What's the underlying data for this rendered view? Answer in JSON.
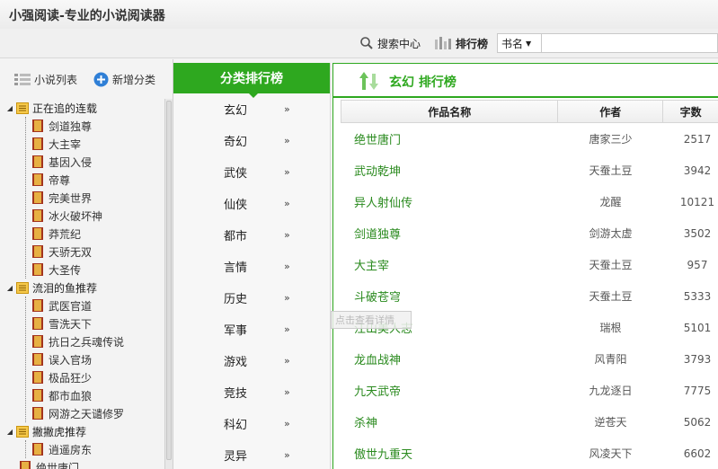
{
  "window": {
    "title": "小强阅读-专业的小说阅读器"
  },
  "toolbar": {
    "search_label": "搜索中心",
    "rank_label": "排行榜",
    "select_value": "书名"
  },
  "sidebar": {
    "novel_list_label": "小说列表",
    "add_category_label": "新增分类",
    "groups": [
      {
        "label": "正在追的连载",
        "items": [
          "剑道独尊",
          "大主宰",
          "基因入侵",
          "帝尊",
          "完美世界",
          "冰火破坏神",
          "莽荒纪",
          "天骄无双",
          "大圣传"
        ]
      },
      {
        "label": "流泪的鱼推荐",
        "items": [
          "武医官道",
          "雪洗天下",
          "抗日之兵魂传说",
          "误入官场",
          "极品狂少",
          "都市血狼",
          "网游之天谴修罗"
        ]
      },
      {
        "label": "撇撇虎推荐",
        "items": [
          "逍遥房东"
        ]
      }
    ],
    "trailing_item": "绝世唐门"
  },
  "categories": {
    "header": "分类排行榜",
    "chevron": "»",
    "items": [
      "玄幻",
      "奇幻",
      "武侠",
      "仙侠",
      "都市",
      "言情",
      "历史",
      "军事",
      "游戏",
      "竞技",
      "科幻",
      "灵异"
    ]
  },
  "ranking": {
    "title": "玄幻 排行榜",
    "columns": [
      "作品名称",
      "作者",
      "字数"
    ],
    "rows": [
      {
        "name": "绝世唐门",
        "author": "唐家三少",
        "words": "2517"
      },
      {
        "name": "武动乾坤",
        "author": "天蚕土豆",
        "words": "3942"
      },
      {
        "name": "异人射仙传",
        "author": "龙醒",
        "words": "10121"
      },
      {
        "name": "剑道独尊",
        "author": "剑游太虚",
        "words": "3502"
      },
      {
        "name": "大主宰",
        "author": "天蚕土豆",
        "words": "957"
      },
      {
        "name": "斗破苍穹",
        "author": "天蚕土豆",
        "words": "5333"
      },
      {
        "name": "江山美人志",
        "author": "瑞根",
        "words": "5101"
      },
      {
        "name": "龙血战神",
        "author": "风青阳",
        "words": "3793"
      },
      {
        "name": "九天武帝",
        "author": "九龙逐日",
        "words": "7775"
      },
      {
        "name": "杀神",
        "author": "逆苍天",
        "words": "5062"
      },
      {
        "name": "傲世九重天",
        "author": "风凌天下",
        "words": "6602"
      }
    ]
  },
  "tooltip": {
    "text": "点击查看详情"
  },
  "colors": {
    "accent": "#2ea81f",
    "link": "#2a8a1e"
  }
}
